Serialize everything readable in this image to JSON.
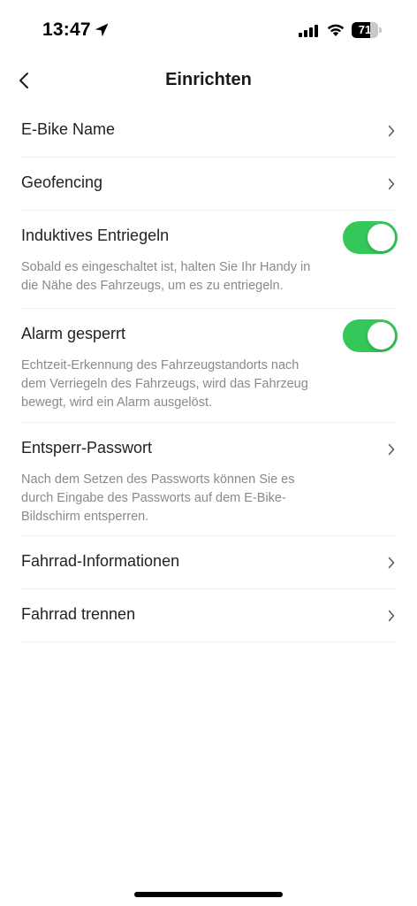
{
  "status_bar": {
    "time": "13:47",
    "battery_level": 71,
    "battery_text": "71"
  },
  "header": {
    "title": "Einrichten"
  },
  "settings": {
    "ebike_name": {
      "label": "E-Bike Name"
    },
    "geofencing": {
      "label": "Geofencing"
    },
    "inductive_unlock": {
      "label": "Induktives Entriegeln",
      "enabled": true,
      "description_line1": "Sobald es eingeschaltet ist, halten Sie Ihr Handy in",
      "description_line2": "die Nähe des Fahrzeugs, um es zu entriegeln."
    },
    "alarm_locked": {
      "label": "Alarm gesperrt",
      "enabled": true,
      "description_line1": "Echtzeit-Erkennung des Fahrzeugstandorts nach",
      "description_line2": "dem Verriegeln des Fahrzeugs, wird das Fahrzeug",
      "description_line3": "bewegt, wird ein Alarm ausgelöst."
    },
    "unlock_password": {
      "label": "Entsperr-Passwort",
      "description_line1": "Nach dem Setzen des Passworts können Sie es",
      "description_line2": "durch Eingabe des Passworts auf dem E-Bike-",
      "description_line3": "Bildschirm entsperren."
    },
    "bike_info": {
      "label": "Fahrrad-Informationen"
    },
    "disconnect_bike": {
      "label": "Fahrrad trennen"
    }
  },
  "colors": {
    "toggle_on": "#34c759",
    "text_primary": "#222222",
    "text_secondary": "#8a8a8a",
    "divider": "#efefef"
  }
}
